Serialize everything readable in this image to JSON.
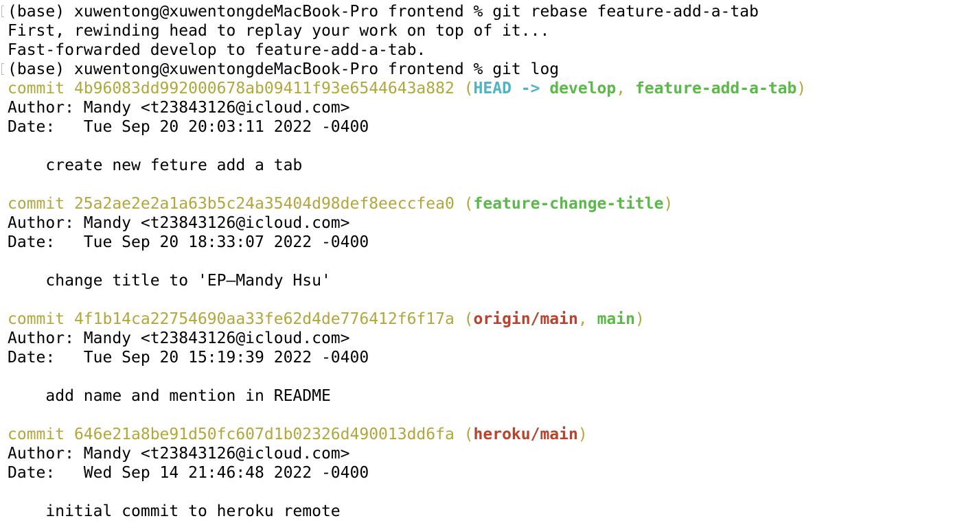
{
  "session": {
    "prompt_1": "(base) xuwentong@xuwentongdeMacBook-Pro frontend % git rebase feature-add-a-tab",
    "rebase_output_1": "First, rewinding head to replay your work on top of it...",
    "rebase_output_2": "Fast-forwarded develop to feature-add-a-tab.",
    "prompt_2": "(base) xuwentong@xuwentongdeMacBook-Pro frontend % git log"
  },
  "log": {
    "commit_word": "commit ",
    "author_prefix": "Author: ",
    "date_prefix": "Date:   ",
    "open_paren": " (",
    "close_paren": ")",
    "comma": ", ",
    "arrow": " -> ",
    "message_indent": "    "
  },
  "commits": [
    {
      "hash": "4b96083dd992000678ab09411f93e6544643a882",
      "head": "HEAD",
      "refs": [
        "develop",
        "feature-add-a-tab"
      ],
      "author": "Mandy <t23843126@icloud.com>",
      "date": "Tue Sep 20 20:03:11 2022 -0400",
      "message": "create new feture add a tab"
    },
    {
      "hash": "25a2ae2e2a1a63b5c24a35404d98def8eeccfea0",
      "refs": [
        "feature-change-title"
      ],
      "author": "Mandy <t23843126@icloud.com>",
      "date": "Tue Sep 20 18:33:07 2022 -0400",
      "message": "change title to 'EP—Mandy Hsu'"
    },
    {
      "hash": "4f1b14ca22754690aa33fe62d4de776412f6f17a",
      "remote_refs": [
        "origin/main"
      ],
      "refs": [
        "main"
      ],
      "author": "Mandy <t23843126@icloud.com>",
      "date": "Tue Sep 20 15:19:39 2022 -0400",
      "message": "add name and mention in README"
    },
    {
      "hash": "646e21a8be91d50fc607d1b02326d490013dd6fa",
      "remote_refs": [
        "heroku/main"
      ],
      "author": "Mandy <t23843126@icloud.com>",
      "date": "Wed Sep 14 21:46:48 2022 -0400",
      "message": "initial commit to heroku remote"
    }
  ],
  "colors": {
    "background": "#ffffff",
    "text": "#000000",
    "commit_hash": "#b3a63a",
    "head_ref": "#4fb4c4",
    "local_branch": "#5bb94a",
    "remote_branch": "#b8432e"
  }
}
